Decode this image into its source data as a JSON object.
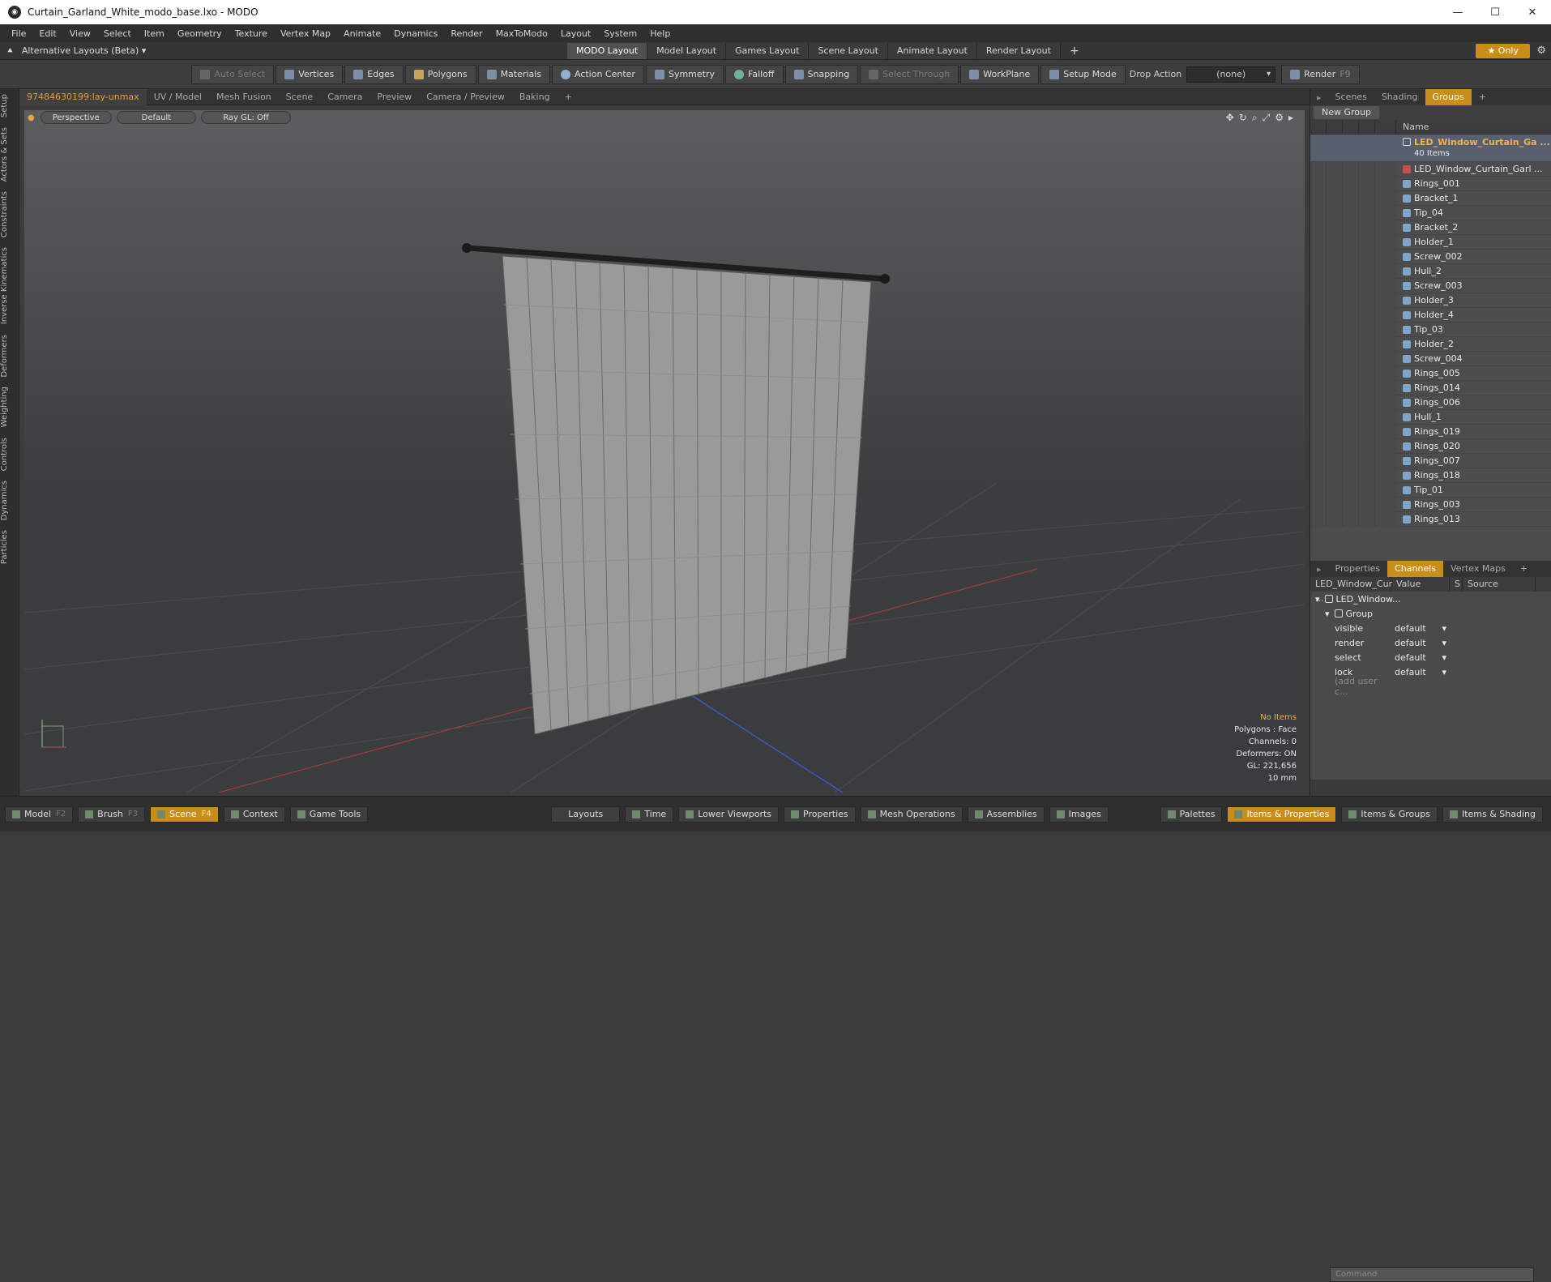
{
  "window": {
    "title": "Curtain_Garland_White_modo_base.lxo - MODO",
    "min": "—",
    "max": "☐",
    "close": "✕"
  },
  "menu": [
    "File",
    "Edit",
    "View",
    "Select",
    "Item",
    "Geometry",
    "Texture",
    "Vertex Map",
    "Animate",
    "Dynamics",
    "Render",
    "MaxToModo",
    "Layout",
    "System",
    "Help"
  ],
  "layouts": {
    "alt_label": "Alternative Layouts (Beta) ▾",
    "tabs": [
      "MODO Layout",
      "Model Layout",
      "Games Layout",
      "Scene Layout",
      "Animate Layout",
      "Render Layout"
    ],
    "add": "+",
    "only": "★ Only"
  },
  "toolbar": {
    "auto_select": "Auto Select",
    "vertices": "Vertices",
    "edges": "Edges",
    "polygons": "Polygons",
    "materials": "Materials",
    "action_center": "Action Center",
    "symmetry": "Symmetry",
    "falloff": "Falloff",
    "snapping": "Snapping",
    "select_through": "Select Through",
    "workplane": "WorkPlane",
    "setup_mode": "Setup Mode",
    "drop_action": "Drop Action",
    "drop_value": "(none)",
    "render": "Render",
    "render_key": "F9"
  },
  "left_tabs": [
    "Setup",
    "Actors & Sets",
    "Constraints",
    "Inverse Kinematics",
    "Deformers",
    "Weighting",
    "Controls",
    "Dynamics",
    "Particles"
  ],
  "viewport_tabs": [
    "97484630199:lay-unmax",
    "UV / Model",
    "Mesh Fusion",
    "Scene",
    "Camera",
    "Preview",
    "Camera / Preview",
    "Baking",
    "+"
  ],
  "viewport": {
    "perspective": "Perspective",
    "default": "Default",
    "raygl": "Ray GL: Off",
    "info": {
      "items": "No Items",
      "polygons": "Polygons : Face",
      "channels": "Channels: 0",
      "deformers": "Deformers: ON",
      "gl": "GL: 221,656",
      "scale": "10 mm"
    }
  },
  "right_tabs": [
    "Scenes",
    "Shading",
    "Groups",
    "+"
  ],
  "groups": {
    "new_group": "New Group",
    "name_header": "Name",
    "root_name": "LED_Window_Curtain_Ga ...",
    "root_count": "40 Items",
    "items": [
      "LED_Window_Curtain_Garl ...",
      "Rings_001",
      "Bracket_1",
      "Tip_04",
      "Bracket_2",
      "Holder_1",
      "Screw_002",
      "Hull_2",
      "Screw_003",
      "Holder_3",
      "Holder_4",
      "Tip_03",
      "Holder_2",
      "Screw_004",
      "Rings_005",
      "Rings_014",
      "Rings_006",
      "Hull_1",
      "Rings_019",
      "Rings_020",
      "Rings_007",
      "Rings_018",
      "Tip_01",
      "Rings_003",
      "Rings_013"
    ]
  },
  "lower_tabs": [
    "Properties",
    "Channels",
    "Vertex Maps",
    "+"
  ],
  "channels": {
    "headers": [
      "LED_Window_Cur ...",
      "Value",
      "S",
      "Source"
    ],
    "root": "LED_Window...",
    "group": "Group",
    "rows": [
      {
        "k": "visible",
        "v": "default"
      },
      {
        "k": "render",
        "v": "default"
      },
      {
        "k": "select",
        "v": "default"
      },
      {
        "k": "lock",
        "v": "default"
      }
    ],
    "add_user": "(add user c...",
    "command_placeholder": "Command"
  },
  "bottom": {
    "left": [
      {
        "label": "Model",
        "key": "F2"
      },
      {
        "label": "Brush",
        "key": "F3"
      },
      {
        "label": "Scene",
        "key": "F4"
      },
      {
        "label": "Context",
        "key": ""
      },
      {
        "label": "Game Tools",
        "key": ""
      }
    ],
    "middle": [
      "Layouts",
      "Time",
      "Lower Viewports",
      "Properties",
      "Mesh Operations",
      "Assemblies",
      "Images"
    ],
    "right": [
      "Palettes",
      "Items & Properties",
      "Items & Groups",
      "Items & Shading"
    ]
  }
}
